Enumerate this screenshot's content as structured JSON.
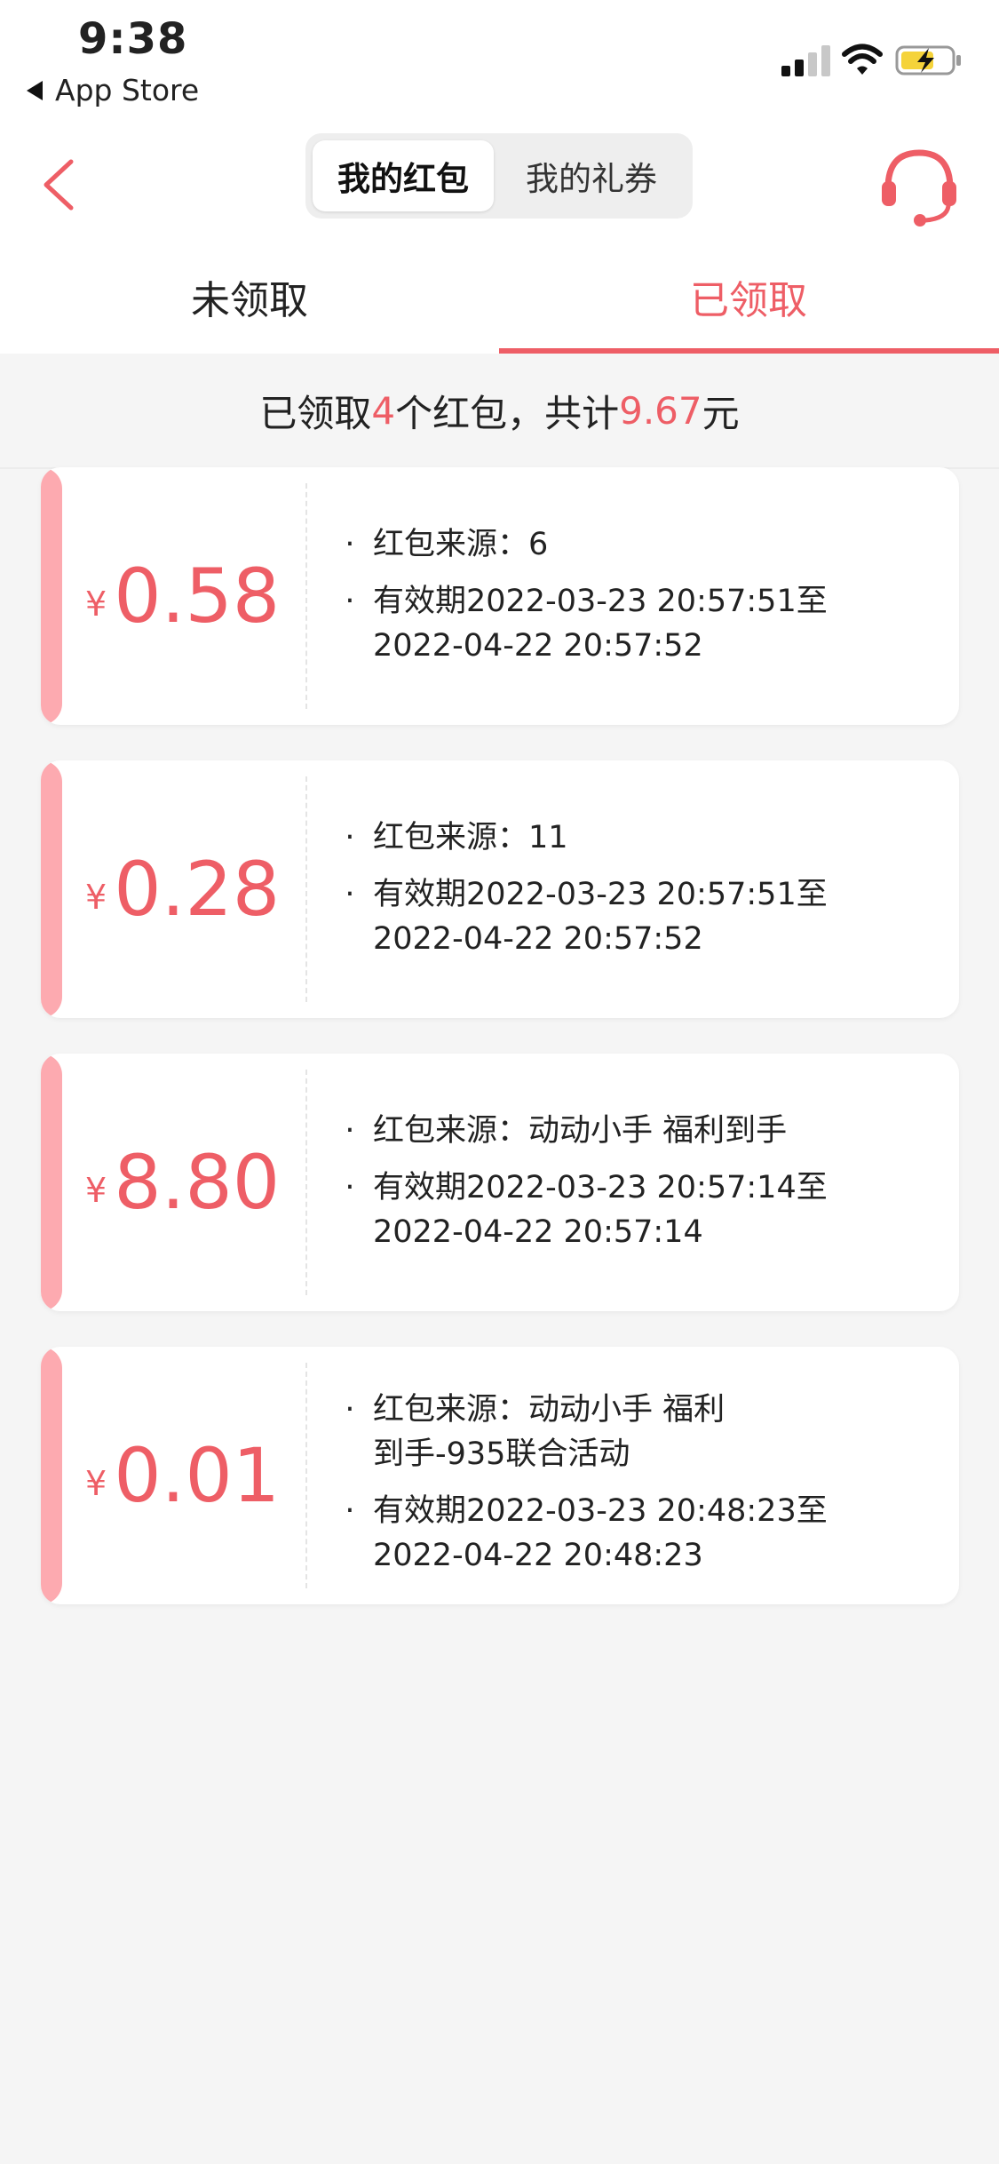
{
  "status": {
    "time": "9:38",
    "back_app_label": "App Store"
  },
  "header": {
    "segment": {
      "active_label": "我的红包",
      "inactive_label": "我的礼券"
    },
    "tabs": [
      {
        "label": "未领取"
      },
      {
        "label": "已领取"
      }
    ]
  },
  "summary": {
    "prefix": "已领取",
    "count": "4",
    "middle": "个红包，共计",
    "total": "9.67",
    "suffix": "元"
  },
  "cards": [
    {
      "currency": "¥",
      "amount": "0.58",
      "bullet": "·",
      "source_label": "红包来源：",
      "source": "6",
      "validity_line1": "有效期2022-03-23 20:57:51至",
      "validity_line2": "2022-04-22 20:57:52"
    },
    {
      "currency": "¥",
      "amount": "0.28",
      "bullet": "·",
      "source_label": "红包来源：",
      "source": "11",
      "validity_line1": "有效期2022-03-23 20:57:51至",
      "validity_line2": "2022-04-22 20:57:52"
    },
    {
      "currency": "¥",
      "amount": "8.80",
      "bullet": "·",
      "source_label": "红包来源：",
      "source": "动动小手 福利到手",
      "validity_line1": "有效期2022-03-23 20:57:14至",
      "validity_line2": "2022-04-22 20:57:14"
    },
    {
      "currency": "¥",
      "amount": "0.01",
      "bullet": "·",
      "source_label": "红包来源：",
      "source": "动动小手 福利",
      "source_line2": "到手-935联合活动",
      "validity_line1": "有效期2022-03-23 20:48:23至",
      "validity_line2": "2022-04-22 20:48:23"
    }
  ],
  "colors": {
    "accent": "#ee5e66",
    "strip": "#fdaab0",
    "background": "#f5f5f5"
  }
}
